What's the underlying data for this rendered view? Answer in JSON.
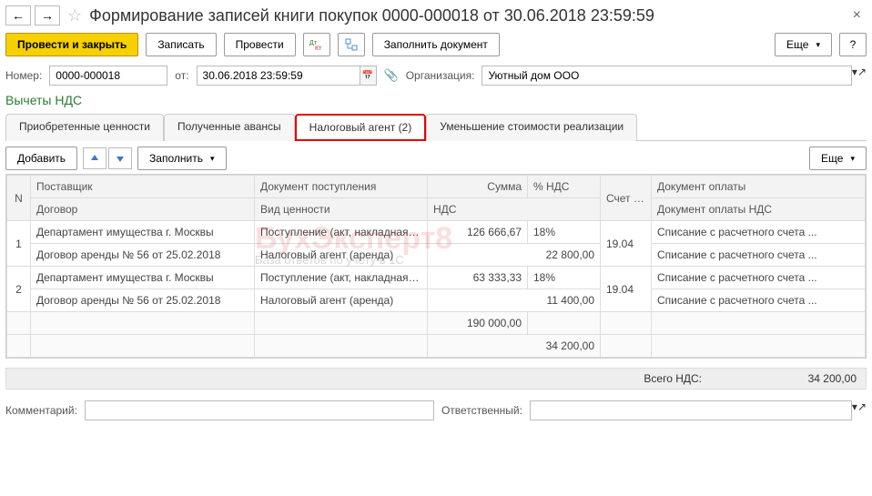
{
  "header": {
    "title": "Формирование записей книги покупок 0000-000018 от 30.06.2018 23:59:59"
  },
  "toolbar": {
    "submit_close": "Провести и закрыть",
    "save": "Записать",
    "submit": "Провести",
    "dtkt": "Дт\nКт",
    "fill_doc": "Заполнить документ",
    "more": "Еще"
  },
  "form": {
    "number_label": "Номер:",
    "number": "0000-000018",
    "date_label": "от:",
    "date": "30.06.2018 23:59:59",
    "org_label": "Организация:",
    "org": "Уютный дом ООО"
  },
  "section_title": "Вычеты НДС",
  "tabs": {
    "t1": "Приобретенные ценности",
    "t2": "Полученные авансы",
    "t3": "Налоговый агент (2)",
    "t4": "Уменьшение стоимости реализации"
  },
  "subbar": {
    "add": "Добавить",
    "fill": "Заполнить",
    "more": "Еще"
  },
  "cols": {
    "n": "N",
    "supplier": "Поставщик",
    "contract": "Договор",
    "doc": "Документ поступления",
    "valuetype": "Вид ценности",
    "sum": "Сумма",
    "vatpct": "% НДС",
    "vat": "НДС",
    "acc": "Счет НДС",
    "paydoc": "Документ оплаты",
    "paydocvat": "Документ оплаты НДС"
  },
  "rows": [
    {
      "n": "1",
      "supplier": "Департамент имущества г. Москвы",
      "contract": "Договор аренды № 56 от 25.02.2018",
      "doc": "Поступление (акт, накладная) ...",
      "valuetype": "Налоговый агент (аренда)",
      "sum": "126 666,67",
      "vatpct": "18%",
      "vat": "22 800,00",
      "acc": "19.04",
      "paydoc": "Списание с расчетного счета ...",
      "paydocvat": "Списание с расчетного счета ..."
    },
    {
      "n": "2",
      "supplier": "Департамент имущества г. Москвы",
      "contract": "Договор аренды № 56 от 25.02.2018",
      "doc": "Поступление (акт, накладная) ...",
      "valuetype": "Налоговый агент (аренда)",
      "sum": "63 333,33",
      "vatpct": "18%",
      "vat": "11 400,00",
      "acc": "19.04",
      "paydoc": "Списание с расчетного счета ...",
      "paydocvat": "Списание с расчетного счета ..."
    }
  ],
  "footer": {
    "sum": "190 000,00",
    "vat": "34 200,00"
  },
  "totals": {
    "label": "Всего НДС:",
    "value": "34 200,00"
  },
  "bottom": {
    "comment_label": "Комментарий:",
    "resp_label": "Ответственный:"
  },
  "watermark": {
    "main": "БухЭксперт8",
    "sub": "База ответов по учету в 1С"
  }
}
